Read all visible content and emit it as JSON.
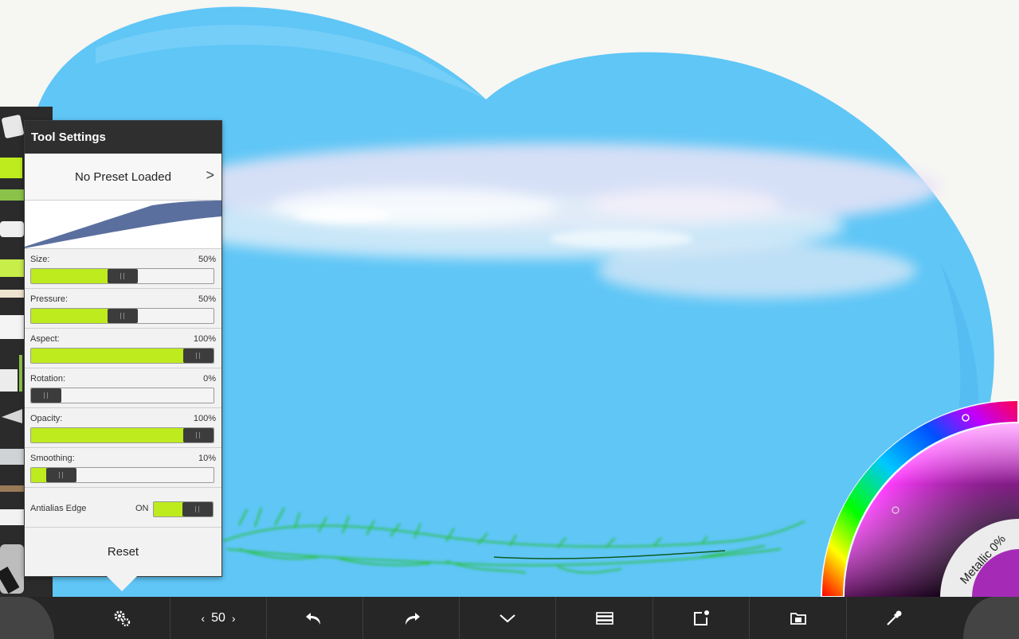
{
  "tool_settings": {
    "title": "Tool Settings",
    "preset_label": "No Preset Loaded",
    "preset_arrow": ">",
    "sliders": [
      {
        "key": "size",
        "label": "Size:",
        "value_text": "50%",
        "value": 0.5
      },
      {
        "key": "pressure",
        "label": "Pressure:",
        "value_text": "50%",
        "value": 0.5
      },
      {
        "key": "aspect",
        "label": "Aspect:",
        "value_text": "100%",
        "value": 1.0
      },
      {
        "key": "rotation",
        "label": "Rotation:",
        "value_text": "0%",
        "value": 0.0
      },
      {
        "key": "opacity",
        "label": "Opacity:",
        "value_text": "100%",
        "value": 1.0
      },
      {
        "key": "smoothing",
        "label": "Smoothing:",
        "value_text": "10%",
        "value": 0.1
      }
    ],
    "antialias": {
      "label": "Antialias Edge",
      "state": "ON",
      "on": true
    },
    "reset_label": "Reset"
  },
  "toolbar": {
    "brush_size": "50",
    "prev_glyph": "‹",
    "next_glyph": "›",
    "buttons": [
      "settings-icon",
      "brush-size",
      "undo-icon",
      "redo-icon",
      "collapse-icon",
      "layers-icon",
      "export-icon",
      "gallery-icon",
      "eyedropper-icon"
    ]
  },
  "color_picker": {
    "metallic_label": "Metallic 0%",
    "current_color": "#a52bb7"
  },
  "colors": {
    "accent": "#bdeb1e",
    "panel_header": "#2f2f2f",
    "toolbar": "#262626",
    "sky": "#5fc6f6",
    "brush_preview": "#5a6f9e"
  }
}
